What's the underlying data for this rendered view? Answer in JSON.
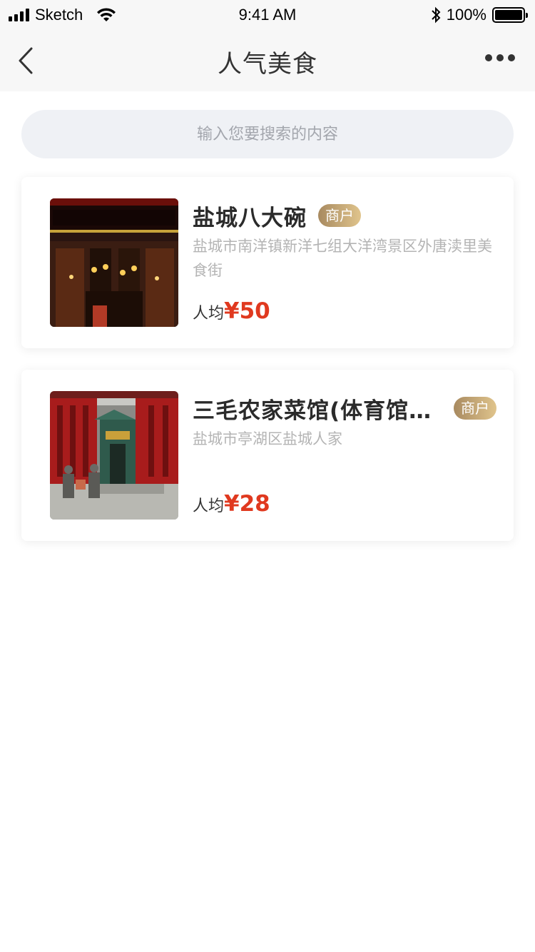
{
  "status_bar": {
    "carrier": "Sketch",
    "time": "9:41 AM",
    "battery": "100%"
  },
  "nav": {
    "title": "人气美食",
    "back_icon": "chevron-left-icon",
    "more_icon": "more-dots-icon"
  },
  "search": {
    "placeholder": "输入您要搜索的内容",
    "value": ""
  },
  "restaurants": [
    {
      "name": "盐城八大碗",
      "badge": "商户",
      "address": "盐城市南洋镇新洋七组大洋湾景区外唐渎里美食街",
      "price_label": "人均",
      "price": "¥50"
    },
    {
      "name": "三毛农家菜馆(体育馆店)",
      "badge": "商户",
      "address": "盐城市亭湖区盐城人家",
      "price_label": "人均",
      "price": "¥28"
    }
  ],
  "colors": {
    "price": "#e0391f",
    "badge_from": "#a88a60",
    "badge_to": "#e0c48c",
    "search_bg": "#eff1f5",
    "nav_bg": "#f7f7f7"
  }
}
